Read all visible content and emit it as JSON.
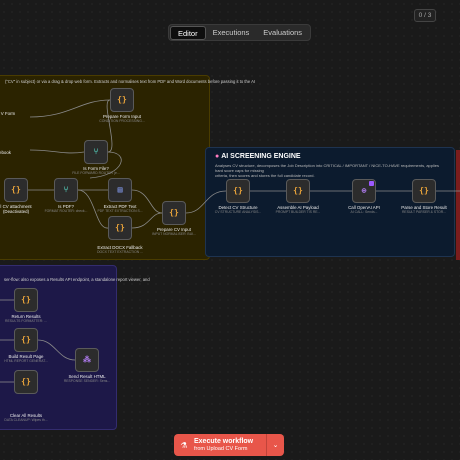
{
  "tabs": {
    "editor": "Editor",
    "executions": "Executions",
    "evaluations": "Evaluations"
  },
  "counter": "0 / 3",
  "sticky_yellow": {
    "text": "(\"CV\" in subject) or via a drag & drop web form. Extracts and normalises text from PDF and Word documents before passing it to the AI"
  },
  "ai_screening": {
    "title": "AI SCREENING ENGINE",
    "description_line1": "Analyses CV structure, decomposes the Job Description into CRITICAL / IMPORTANT / NICE-TO-HAVE requirements, applies hard score caps for missing",
    "description_line2": "criteria, then scores and stores the full candidate record."
  },
  "sticky_purple": {
    "text": "ser-flow: also exposes a Results API endpoint, a standalone report viewer, and"
  },
  "nodes": {
    "pdf_form_input": {
      "label": "Prepare Form Input",
      "sub": "CONDITION PROCESSING..."
    },
    "is_form_file": {
      "label": "Is Form File?",
      "sub": "FILE FORWARD ROUTER (e..."
    },
    "cv_attachment": {
      "label": "l CV attachment",
      "label2": "(Deactivated)"
    },
    "is_pdf": {
      "label": "Is PDF?",
      "sub": "FORMAT ROUTER: check..."
    },
    "extract_pdf": {
      "label": "Extract PDF Text",
      "sub": "PDF TEXT EXTRACTION S..."
    },
    "extract_docx": {
      "label": "Extract DOCX Fallback",
      "sub": "DOCX TEXT EXTRACTION ..."
    },
    "prepare_cv": {
      "label": "Prepare CV Input",
      "sub": "INPUT NORMALISER: BUI..."
    },
    "detect_cv": {
      "label": "Detect CV Structure",
      "sub": "CV STRUCTURE ANALYSIS..."
    },
    "assemble_ai": {
      "label": "Assemble AI Payload",
      "sub": "PROMPT BUILDER TIS RE..."
    },
    "call_openai": {
      "label": "Call OpenAI API",
      "sub": "AI CALL: Sends..."
    },
    "parse_store": {
      "label": "Parse and Store Result",
      "sub": "RESULT PARSER & STOR..."
    },
    "return_results": {
      "label": "Return Results",
      "sub": "RESULTS FORMATTER: ..."
    },
    "build_result": {
      "label": "Build Result Page",
      "sub": "HTML REPORT GENERAT..."
    },
    "send_result": {
      "label": "Send Result HTML",
      "sub": "RESPONSE SENDER: Sens..."
    },
    "clear_all": {
      "label": "Clear All Results",
      "sub": "DATA CLEANUP: Wipes th..."
    },
    "form_left": {
      "label": "V Form"
    },
    "hook_left": {
      "label": "ebook"
    }
  },
  "execute_button": {
    "line1": "Execute workflow",
    "line2": "from Upload CV Form"
  },
  "colors": {
    "accent": "#e8564a",
    "code_icon": "#e8a33a",
    "teal": "#4fb8a8",
    "ai_purple": "#b07cf0"
  },
  "icons": {
    "code": "{}",
    "router": "switch-icon",
    "ai": "openai-icon",
    "webhook": "webhook-icon",
    "play": "play-icon"
  }
}
